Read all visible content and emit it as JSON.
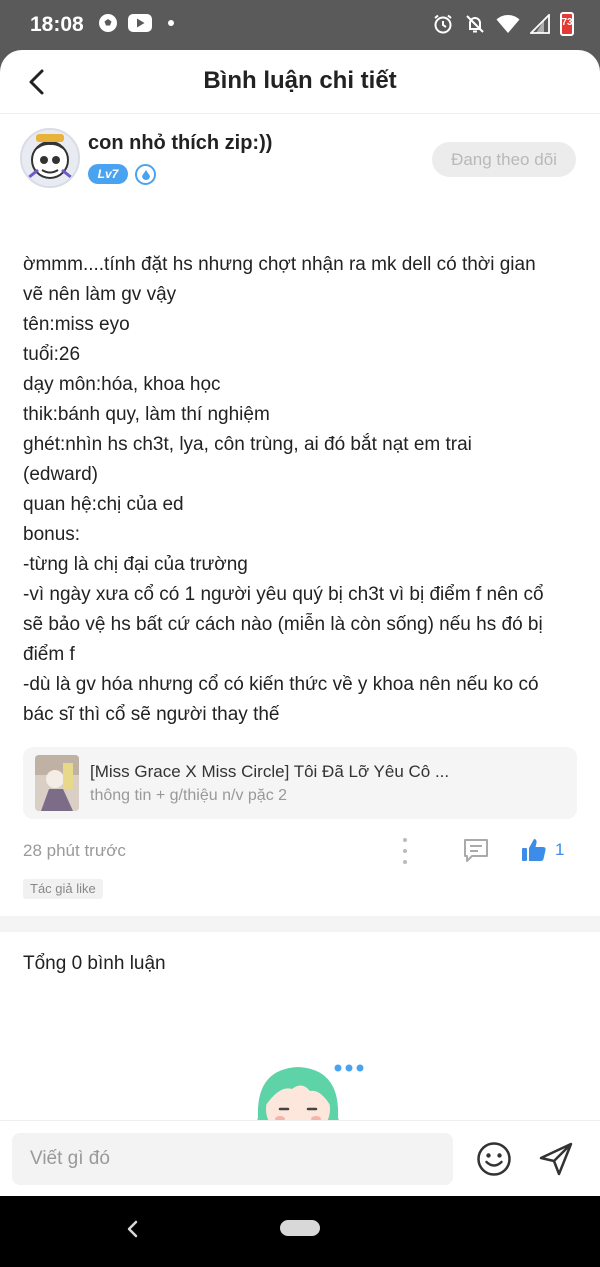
{
  "status_bar": {
    "time": "18:08",
    "battery_level": "73",
    "icons": [
      "soccer-ball-icon",
      "youtube-icon",
      "notification-dot",
      "alarm-icon",
      "mute-icon",
      "wifi-icon",
      "signal-icon",
      "battery-icon"
    ]
  },
  "header": {
    "back_icon": "chevron-left-icon",
    "title": "Bình luận chi tiết"
  },
  "post": {
    "username": "con nhỏ thích zip:))",
    "level": "Lv7",
    "follow_label": "Đang theo dõi",
    "lines": [
      "ờmmm....tính đặt hs nhưng chợt nhận ra mk dell có thời gian",
      "vẽ nên làm gv vậy",
      "tên:miss eyo",
      "tuổi:26",
      "dạy môn:hóa, khoa học",
      "thik:bánh quy, làm thí nghiệm",
      "ghét:nhìn hs ch3t, lya, côn trùng, ai đó bắt nạt em trai",
      "(edward)",
      "quan hệ:chị của ed",
      "bonus:",
      "-từng là chị đại của trường",
      "-vì ngày xưa cổ có 1 người yêu quý bị ch3t vì bị điểm f nên cổ",
      "sẽ bảo vệ hs bất cứ cách nào (miễn là còn sống) nếu hs đó bị",
      "điểm f",
      "-dù là gv hóa nhưng cổ có kiến thức về y khoa nên nếu ko có",
      "bác sĩ thì cổ sẽ người thay thế"
    ],
    "story": {
      "title": "[Miss Grace X Miss Circle] Tôi Đã Lỡ Yêu Cô ...",
      "subtitle": "thông tin + g/thiệu n/v pặc 2"
    },
    "timestamp": "28 phút trước",
    "like_count": "1",
    "author_like_tag": "Tác giả like"
  },
  "comments": {
    "total_label": "Tổng 0 bình luận"
  },
  "composer": {
    "placeholder": "Viết gì đó"
  },
  "colors": {
    "accent": "#3b8de8",
    "status_bar": "#5a5a5a",
    "nav_bar": "#000000"
  }
}
